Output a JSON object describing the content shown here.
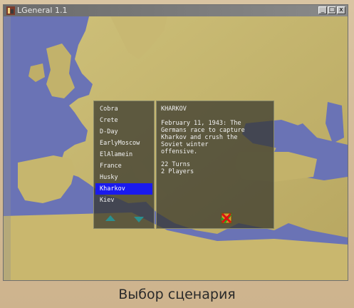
{
  "window": {
    "title": "LGeneral 1.1",
    "controls": {
      "minimize": "_",
      "maximize": "□",
      "close": "x"
    }
  },
  "scenarios": {
    "items": [
      "Cobra",
      "Crete",
      "D-Day",
      "EarlyMoscow",
      "ElAlamein",
      "France",
      "Husky",
      "Kharkov",
      "Kiev"
    ],
    "selected_index": 7
  },
  "info": {
    "title": "KHARKOV",
    "description": "February 11, 1943: The\nGermans race to capture\nKharkov and crush the\nSoviet winter\noffensive.",
    "turns": "22 Turns",
    "players": "2 Players"
  },
  "icons": {
    "scroll_up": "arrow-up-icon",
    "scroll_down": "arrow-down-icon",
    "settings": "settings-icon",
    "ok": "checkmark-icon",
    "cancel": "cross-icon"
  },
  "colors": {
    "selection": "#1a1aee",
    "sea": "#6a73b5",
    "land": "#c9b76e",
    "ok": "#22aa22",
    "cancel": "#dd1111"
  },
  "caption": "Выбор сценария"
}
